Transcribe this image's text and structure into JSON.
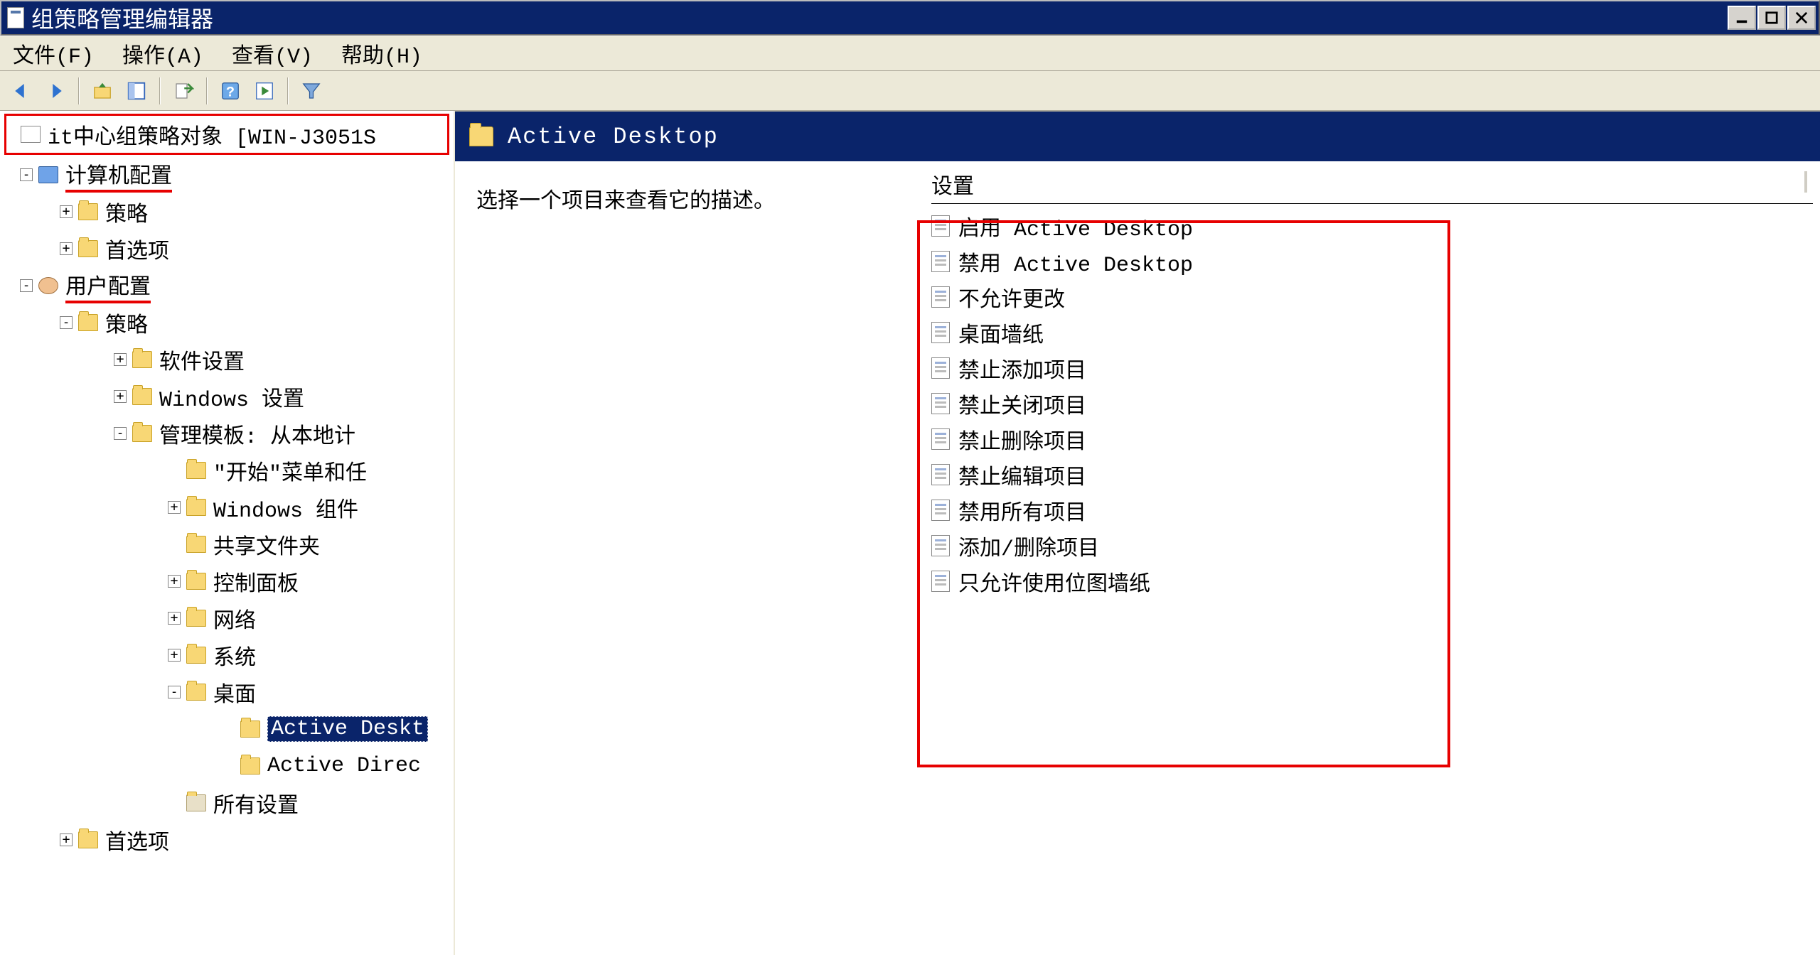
{
  "window": {
    "title": "组策略管理编辑器",
    "controls": {
      "minimize": "_",
      "maximize": "□",
      "close": "×"
    }
  },
  "menu": {
    "file": "文件(F)",
    "action": "操作(A)",
    "view": "查看(V)",
    "help": "帮助(H)"
  },
  "toolbar_icons": {
    "back": "back-arrow",
    "forward": "forward-arrow",
    "up": "folder-up",
    "show": "properties-pane",
    "export": "export-list",
    "help": "help-icon",
    "run": "run-icon",
    "filter": "filter-funnel"
  },
  "tree": {
    "root": "it中心组策略对象 [WIN-J3051S",
    "computer_config": "计算机配置",
    "computer_children": {
      "policies": "策略",
      "preferences": "首选项"
    },
    "user_config": "用户配置",
    "user_policies": "策略",
    "software_settings": "软件设置",
    "windows_settings": "Windows 设置",
    "admin_templates": "管理模板: 从本地计",
    "start_menu": "\"开始\"菜单和任",
    "windows_components": "Windows 组件",
    "shared_folders": "共享文件夹",
    "control_panel": "控制面板",
    "network": "网络",
    "system": "系统",
    "desktop": "桌面",
    "active_desktop": "Active Deskt",
    "active_directory": "Active Direc",
    "all_settings": "所有设置",
    "user_preferences": "首选项"
  },
  "right": {
    "folder_title": "Active Desktop",
    "description_prompt": "选择一个项目来查看它的描述。",
    "settings_header": "设置",
    "settings": [
      "启用 Active Desktop",
      "禁用 Active Desktop",
      "不允许更改",
      "桌面墙纸",
      "禁止添加项目",
      "禁止关闭项目",
      "禁止删除项目",
      "禁止编辑项目",
      "禁用所有项目",
      "添加/删除项目",
      "只允许使用位图墙纸"
    ]
  }
}
